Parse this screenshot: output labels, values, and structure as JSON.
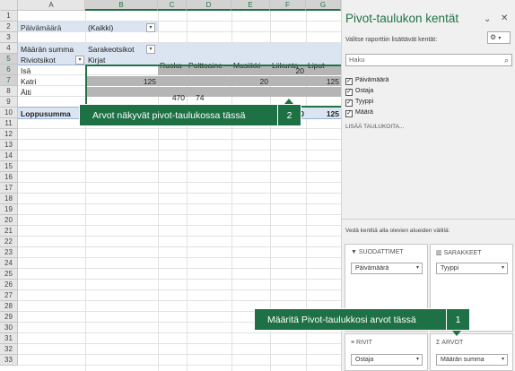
{
  "columns": [
    "A",
    "B",
    "C",
    "D",
    "E",
    "F",
    "G"
  ],
  "rows": [
    "1",
    "2",
    "3",
    "4",
    "5",
    "6",
    "7",
    "8",
    "9",
    "10",
    "11",
    "12",
    "13",
    "14",
    "15",
    "16",
    "17",
    "18",
    "19",
    "20",
    "21",
    "22",
    "23",
    "24",
    "25",
    "26",
    "27",
    "28",
    "29",
    "30",
    "31",
    "32",
    "33"
  ],
  "pivot": {
    "filter_label": "Päivämäärä",
    "filter_value": "(Kaikki)",
    "values_label": "Määrän summa",
    "col_labels_header": "Sarakeotsikot",
    "row_labels_header": "Riviotsikot",
    "categories": [
      "Kirjat",
      "Ruoka",
      "Polttoaine",
      "Musiikki",
      "Liikunta",
      "Liput"
    ],
    "rows": [
      {
        "label": "Isä",
        "values": [
          "",
          "",
          "",
          "",
          "20",
          ""
        ]
      },
      {
        "label": "Katri",
        "values": [
          "125",
          "",
          "",
          "20",
          "",
          "125"
        ]
      },
      {
        "label": "Äiti",
        "values": [
          "",
          "470",
          "74",
          "",
          "",
          ""
        ]
      }
    ],
    "total_label": "Loppusumma",
    "total_values": [
      "",
      "",
      "",
      "",
      "0",
      "125"
    ]
  },
  "callouts": {
    "values_shown": {
      "text": "Arvot näkyvät pivot-taulukossa tässä",
      "num": "2"
    },
    "define_values": {
      "text": "Määritä Pivot-taulukkosi arvot tässä",
      "num": "1"
    }
  },
  "pane": {
    "title": "Pivot-taulukon kentät",
    "subtitle": "Valitse raporttiin lisättävät kentät:",
    "search_placeholder": "Haku",
    "fields": [
      {
        "label": "Päivämäärä",
        "checked": true
      },
      {
        "label": "Ostaja",
        "checked": true
      },
      {
        "label": "Tyyppi",
        "checked": true
      },
      {
        "label": "Määrä",
        "checked": true
      }
    ],
    "more_tables": "LISÄÄ TAULUKOITA...",
    "drag_hint": "Vedä kenttiä alla olevien alueiden välillä:",
    "areas": {
      "filters": {
        "title": "SUODATTIMET",
        "value": "Päivämäärä"
      },
      "columns": {
        "title": "SARAKKEET",
        "value": "Tyyppi"
      },
      "rows": {
        "title": "RIVIT",
        "value": "Ostaja"
      },
      "values": {
        "title": "ARVOT",
        "value": "Määrän summa"
      }
    }
  },
  "colors": {
    "accent": "#217346",
    "callout": "#1e7145",
    "pivot_header": "#dbe5f1",
    "gray_block": "#b5b5b5"
  }
}
